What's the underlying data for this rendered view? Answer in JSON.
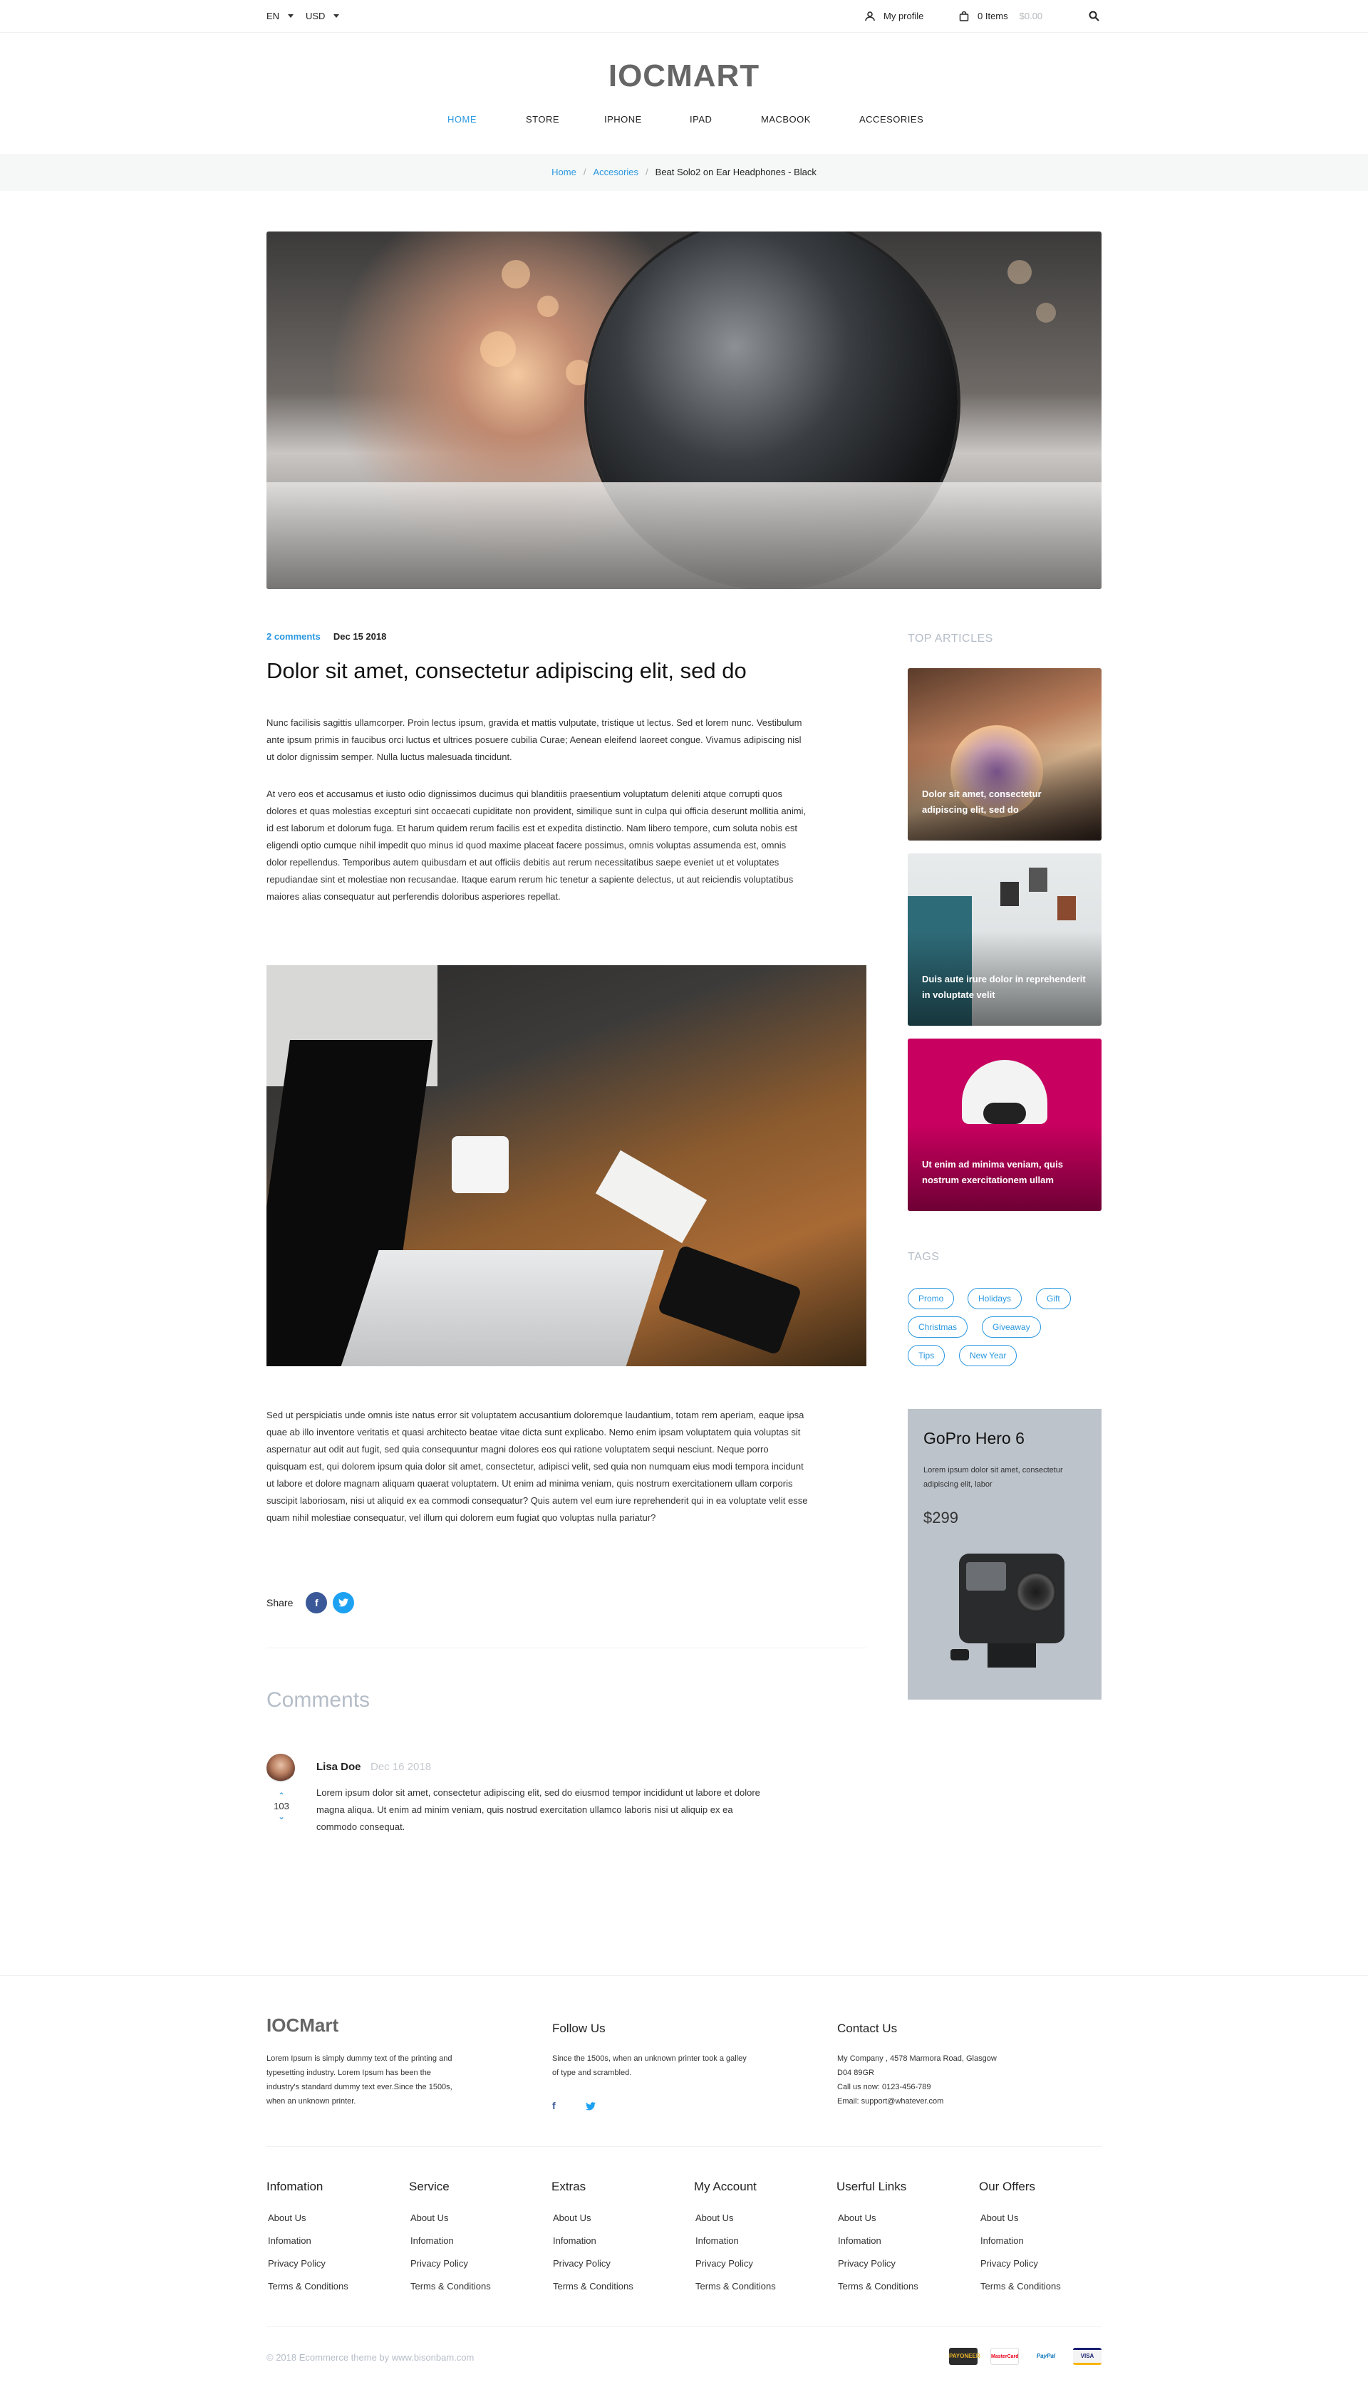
{
  "topbar": {
    "language": "EN",
    "currency": "USD",
    "profile_label": "My profile",
    "cart_label": "0 Items",
    "cart_total": "$0.00"
  },
  "header": {
    "logo": "IOCMART",
    "nav": [
      "HOME",
      "STORE",
      "IPHONE",
      "IPAD",
      "MACBOOK",
      "ACCESORIES"
    ]
  },
  "breadcrumb": {
    "home": "Home",
    "category": "Accesories",
    "current": "Beat Solo2 on Ear Headphones - Black"
  },
  "article": {
    "comments_count": "2 comments",
    "date": "Dec 15 2018",
    "title": "Dolor sit amet, consectetur adipiscing elit, sed do",
    "para1": "Nunc facilisis sagittis ullamcorper. Proin lectus ipsum, gravida et mattis vulputate, tristique ut lectus. Sed et lorem nunc. Vestibulum ante ipsum primis in faucibus orci luctus et ultrices posuere cubilia Curae; Aenean eleifend laoreet congue. Vivamus adipiscing nisl ut dolor dignissim semper. Nulla luctus malesuada tincidunt.",
    "para2": "At vero eos et accusamus et iusto odio dignissimos ducimus qui blanditiis praesentium voluptatum deleniti atque corrupti quos dolores et quas molestias excepturi sint occaecati cupiditate non provident, similique sunt in culpa qui officia deserunt mollitia animi, id est laborum et dolorum fuga. Et harum quidem rerum facilis est et expedita distinctio. Nam libero tempore, cum soluta nobis est eligendi optio cumque nihil impedit quo minus id quod maxime placeat facere possimus, omnis voluptas assumenda est, omnis dolor repellendus. Temporibus autem quibusdam et aut officiis debitis aut rerum necessitatibus saepe eveniet ut et voluptates repudiandae sint et molestiae non recusandae. Itaque earum rerum hic tenetur a sapiente delectus, ut aut reiciendis voluptatibus maiores alias consequatur aut perferendis doloribus asperiores repellat.",
    "para3": "Sed ut perspiciatis unde omnis iste natus error sit voluptatem accusantium doloremque laudantium, totam rem aperiam, eaque ipsa quae ab illo inventore veritatis et quasi architecto beatae vitae dicta sunt explicabo. Nemo enim ipsam voluptatem quia voluptas sit aspernatur aut odit aut fugit, sed quia consequuntur magni dolores eos qui ratione voluptatem sequi nesciunt. Neque porro quisquam est, qui dolorem ipsum quia dolor sit amet, consectetur, adipisci velit, sed quia non numquam eius modi tempora incidunt ut labore et dolore magnam aliquam quaerat voluptatem. Ut enim ad minima veniam, quis nostrum exercitationem ullam corporis suscipit laboriosam, nisi ut aliquid ex ea commodi consequatur? Quis autem vel eum iure reprehenderit qui in ea voluptate velit esse quam nihil molestiae consequatur, vel illum qui dolorem eum fugiat quo voluptas nulla pariatur?",
    "share_label": "Share"
  },
  "comments": {
    "heading": "Comments",
    "items": [
      {
        "author": "Lisa Doe",
        "date": "Dec 16 2018",
        "votes": "103",
        "text": "Lorem ipsum dolor sit amet, consectetur adipiscing elit, sed do eiusmod tempor incididunt ut labore et dolore magna aliqua. Ut enim ad minim veniam, quis nostrud exercitation ullamco laboris nisi ut aliquip ex ea commodo consequat."
      }
    ]
  },
  "sidebar": {
    "top_articles_heading": "TOP ARTICLES",
    "articles": [
      {
        "caption": "Dolor sit amet, consectetur adipiscing elit, sed do"
      },
      {
        "caption": "Duis aute irure dolor in reprehenderit in voluptate velit"
      },
      {
        "caption": "Ut enim ad minima veniam, quis nostrum exercitationem ullam"
      }
    ],
    "tags_heading": "TAGS",
    "tags": [
      "Promo",
      "Holidays",
      "Gift",
      "Christmas",
      "Giveaway",
      "Tips",
      "New Year"
    ],
    "promo": {
      "title": "GoPro Hero 6",
      "desc": "Lorem ipsum dolor sit amet, consectetur adipiscing elit, labor",
      "price": "$299"
    }
  },
  "footer": {
    "brand": "IOCMart",
    "brand_text": "Lorem Ipsum is simply dummy text of the printing and typesetting industry. Lorem Ipsum has been the industry's standard dummy text ever.Since the 1500s, when an unknown printer.",
    "follow_heading": "Follow Us",
    "follow_text": "Since the 1500s, when an unknown printer took a galley of type and scrambled.",
    "contact_heading": "Contact Us",
    "contact_lines": [
      "My Company , 4578 Marmora Road, Glasgow",
      "D04 89GR",
      "Call us now: 0123-456-789",
      "Email: support@whatever.com"
    ],
    "columns": [
      {
        "heading": "Infomation",
        "links": [
          "About Us",
          "Infomation",
          "Privacy Policy",
          "Terms & Conditions"
        ]
      },
      {
        "heading": "Service",
        "links": [
          "About Us",
          "Infomation",
          "Privacy Policy",
          "Terms & Conditions"
        ]
      },
      {
        "heading": "Extras",
        "links": [
          "About Us",
          "Infomation",
          "Privacy Policy",
          "Terms & Conditions"
        ]
      },
      {
        "heading": "My Account",
        "links": [
          "About Us",
          "Infomation",
          "Privacy Policy",
          "Terms & Conditions"
        ]
      },
      {
        "heading": "Userful Links",
        "links": [
          "About Us",
          "Infomation",
          "Privacy Policy",
          "Terms & Conditions"
        ]
      },
      {
        "heading": "Our Offers",
        "links": [
          "About Us",
          "Infomation",
          "Privacy Policy",
          "Terms & Conditions"
        ]
      }
    ],
    "copyright": "© 2018 Ecommerce theme by www.bisonbam.com",
    "payments": [
      "PAYONEER",
      "MasterCard",
      "PayPal",
      "VISA"
    ]
  },
  "colors": {
    "accent": "#2b98e0",
    "facebook": "#3b5998",
    "twitter": "#1da1f2",
    "promo_bg": "#bcc3cb",
    "card3": "#c8005f"
  }
}
